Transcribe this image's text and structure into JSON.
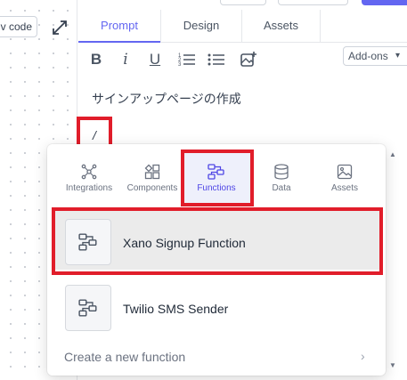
{
  "left_panel": {
    "view_code_label": "v code"
  },
  "tabs": [
    {
      "label": "Prompt"
    },
    {
      "label": "Design"
    },
    {
      "label": "Assets"
    }
  ],
  "toolbar": {
    "bold": "B",
    "italic": "i",
    "underline": "U",
    "addons_label": "Add-ons",
    "addons_caret": "▾"
  },
  "editor": {
    "text": "サインアップページの作成",
    "slash": "/"
  },
  "popup": {
    "categories": [
      {
        "label": "Integrations",
        "icon": "integrations-icon"
      },
      {
        "label": "Components",
        "icon": "components-icon"
      },
      {
        "label": "Functions",
        "icon": "functions-icon",
        "selected": true
      },
      {
        "label": "Data",
        "icon": "database-icon"
      },
      {
        "label": "Assets",
        "icon": "image-icon"
      }
    ],
    "items": [
      {
        "label": "Xano Signup Function",
        "icon": "function-icon",
        "highlighted": true
      },
      {
        "label": "Twilio SMS Sender",
        "icon": "function-icon"
      }
    ],
    "create_new_label": "Create a new function",
    "chevron": "›",
    "scroll_up": "▲",
    "scroll_down": "▼"
  },
  "colors": {
    "accent": "#6366f1",
    "highlight_red": "#e11d2a",
    "selected_bg": "#ebebeb"
  }
}
